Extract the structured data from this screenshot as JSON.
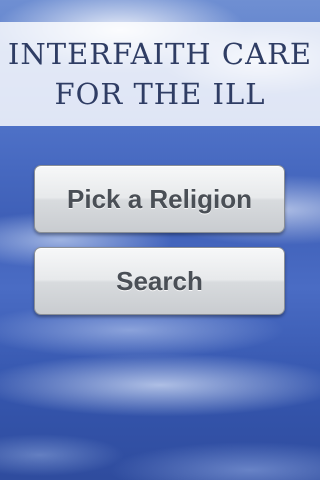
{
  "header": {
    "title_line1": "INTERFAITH CARE",
    "title_line2": "FOR THE ILL"
  },
  "menu": {
    "pick_religion_label": "Pick a Religion",
    "search_label": "Search"
  }
}
